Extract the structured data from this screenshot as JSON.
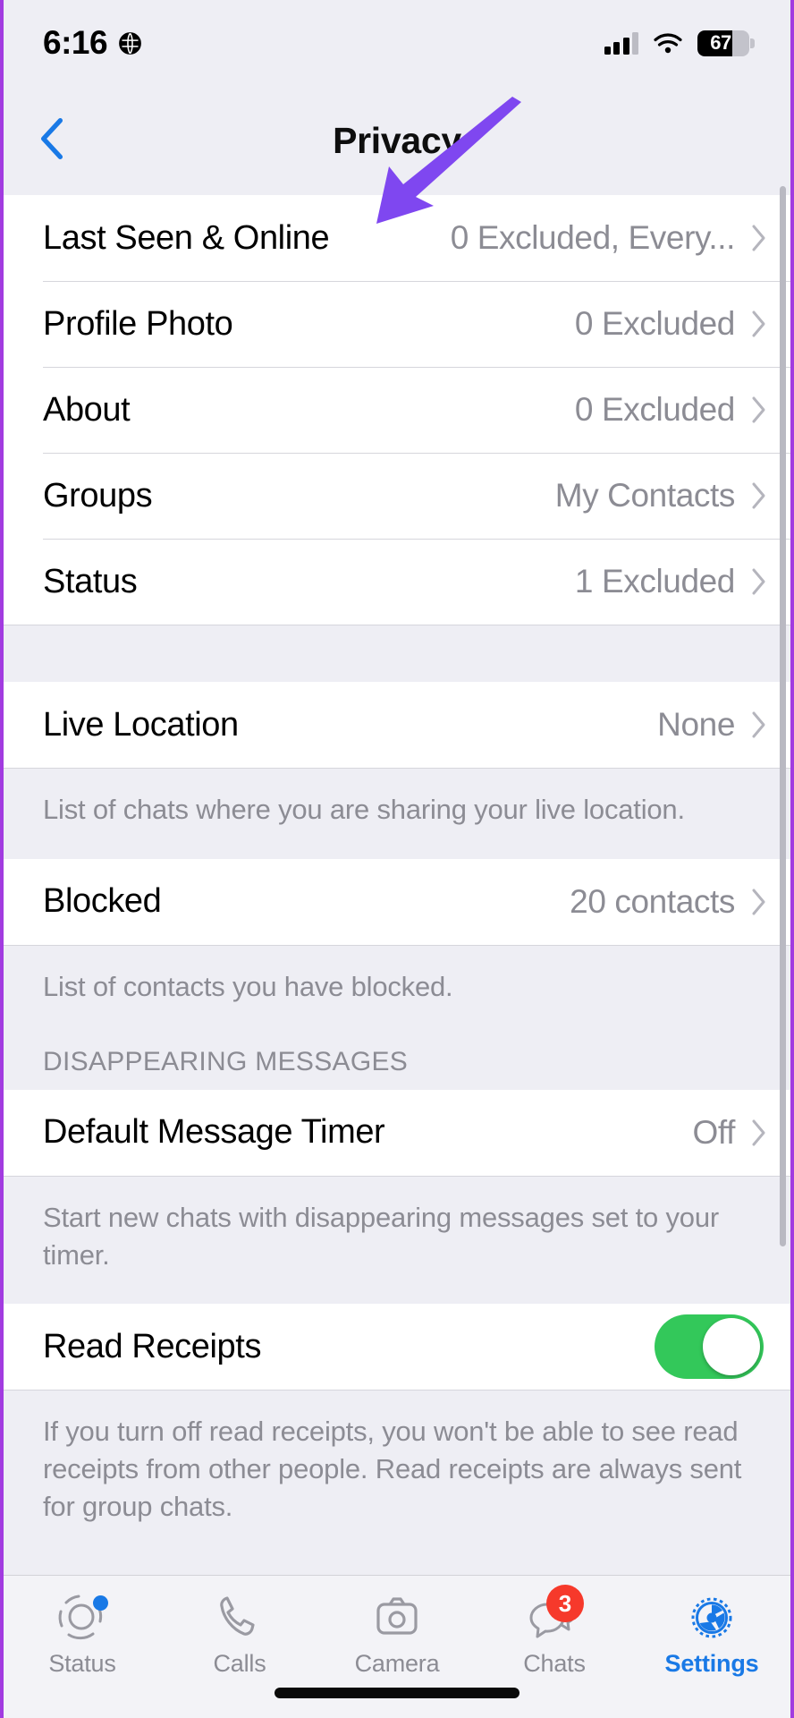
{
  "status_bar": {
    "time": "6:16",
    "location_icon": "globe-icon",
    "signal_icon": "cellular-signal-icon",
    "wifi_icon": "wifi-icon",
    "battery_percent": "67"
  },
  "nav": {
    "back_icon": "chevron-left-icon",
    "title": "Privacy"
  },
  "sections": {
    "visibility": {
      "rows": [
        {
          "label": "Last Seen & Online",
          "value": "0 Excluded, Every..."
        },
        {
          "label": "Profile Photo",
          "value": "0 Excluded"
        },
        {
          "label": "About",
          "value": "0 Excluded"
        },
        {
          "label": "Groups",
          "value": "My Contacts"
        },
        {
          "label": "Status",
          "value": "1 Excluded"
        }
      ]
    },
    "live_location": {
      "row": {
        "label": "Live Location",
        "value": "None"
      },
      "footnote": "List of chats where you are sharing your live location."
    },
    "blocked": {
      "row": {
        "label": "Blocked",
        "value": "20 contacts"
      },
      "footnote": "List of contacts you have blocked."
    },
    "disappearing": {
      "header": "DISAPPEARING MESSAGES",
      "row": {
        "label": "Default Message Timer",
        "value": "Off"
      },
      "footnote": "Start new chats with disappearing messages set to your timer."
    },
    "read_receipts": {
      "label": "Read Receipts",
      "toggle_state": "on",
      "footnote": "If you turn off read receipts, you won't be able to see read receipts from other people. Read receipts are always sent for group chats."
    }
  },
  "tabbar": {
    "items": [
      {
        "label": "Status",
        "icon": "status-rings-icon",
        "active": false,
        "dot": true
      },
      {
        "label": "Calls",
        "icon": "phone-icon",
        "active": false,
        "dot": false
      },
      {
        "label": "Camera",
        "icon": "camera-icon",
        "active": false,
        "dot": false
      },
      {
        "label": "Chats",
        "icon": "chat-bubbles-icon",
        "active": false,
        "badge": "3"
      },
      {
        "label": "Settings",
        "icon": "gear-icon",
        "active": true,
        "dot": false
      }
    ]
  },
  "annotation": {
    "arrow_icon": "purple-pointer-arrow",
    "arrow_color": "#7f47f0"
  },
  "colors": {
    "accent_blue": "#1979e6",
    "toggle_green": "#33c85a",
    "badge_red": "#f6392b",
    "page_bg": "#eeeef4",
    "row_bg": "#ffffff",
    "secondary_text": "#8c8c94"
  }
}
